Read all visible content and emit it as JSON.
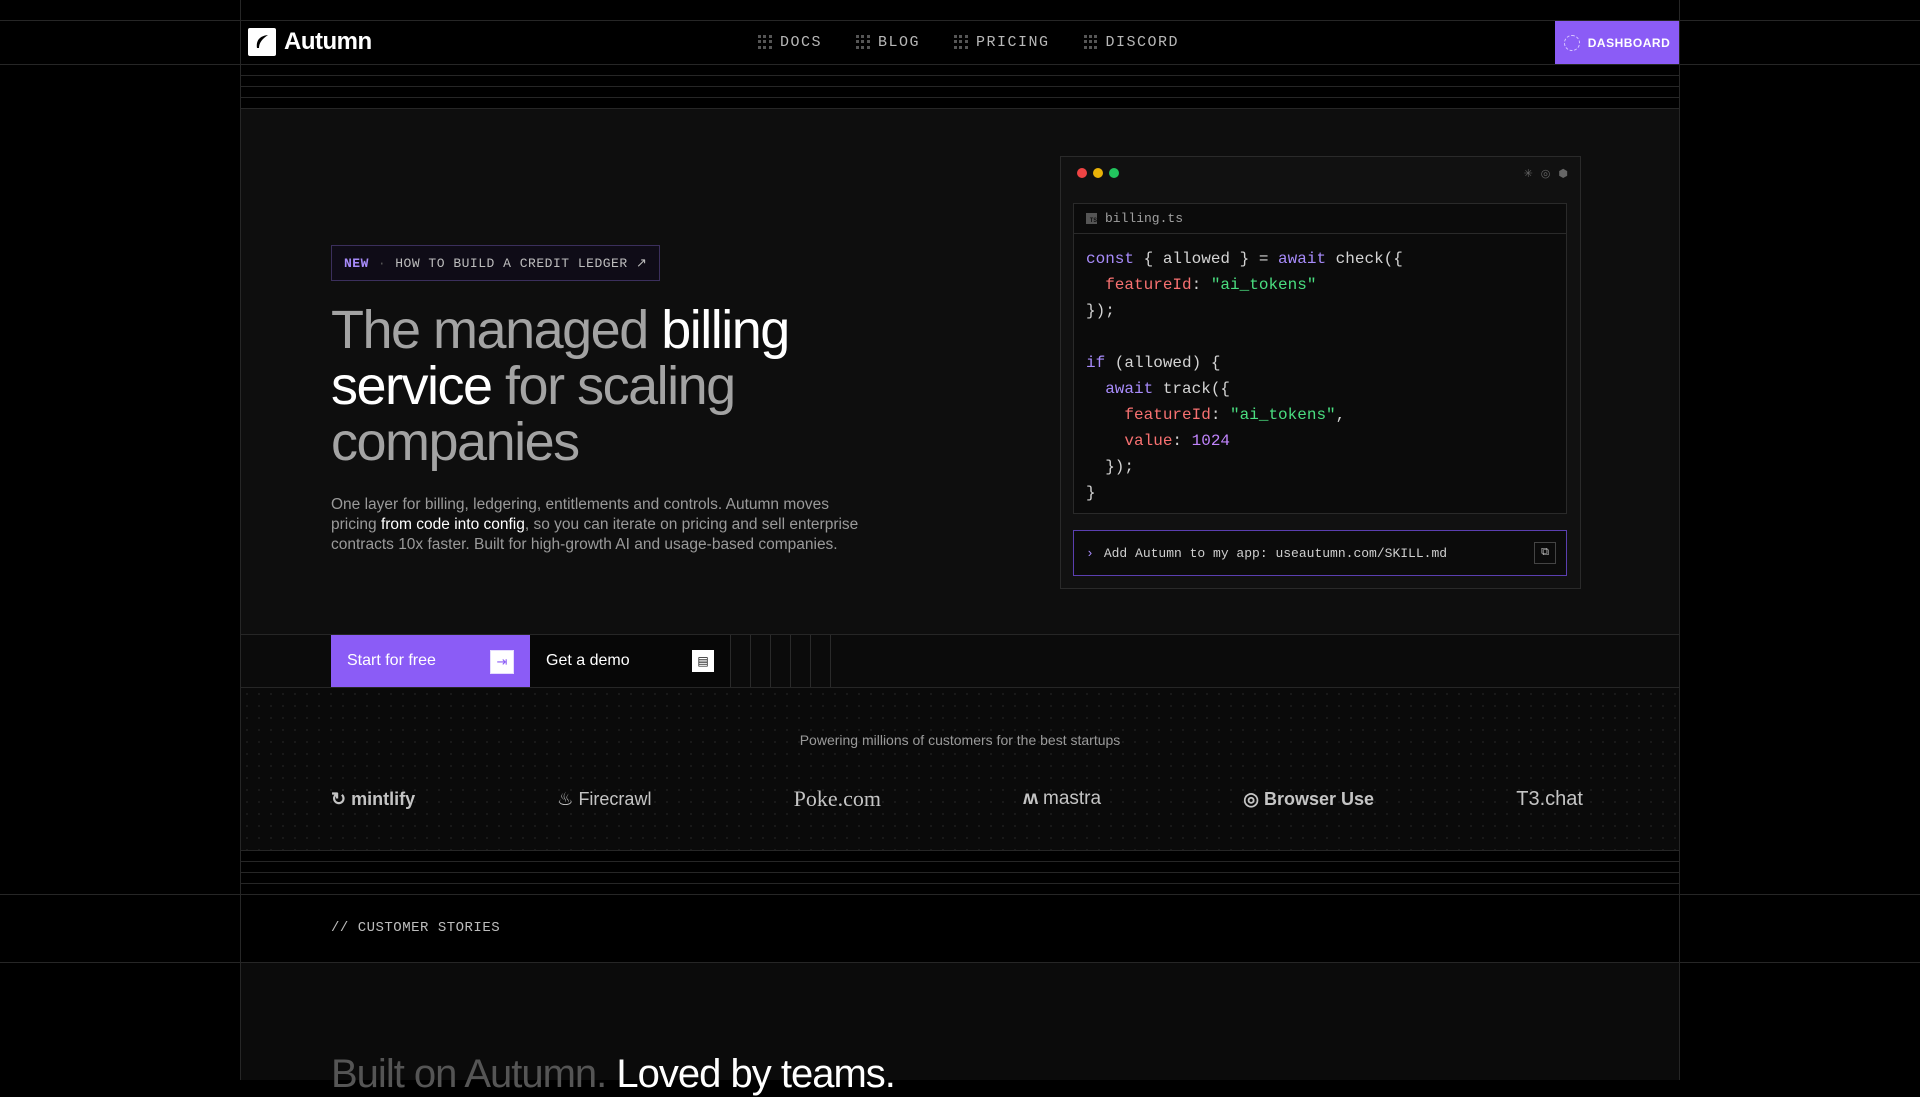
{
  "brand": {
    "name": "Autumn"
  },
  "nav": {
    "items": [
      {
        "label": "DOCS"
      },
      {
        "label": "BLOG"
      },
      {
        "label": "PRICING"
      },
      {
        "label": "DISCORD"
      }
    ],
    "dashboard_label": "DASHBOARD"
  },
  "hero": {
    "badge_new": "NEW",
    "badge_sep": "·",
    "badge_text": "HOW TO BUILD A CREDIT LEDGER ↗",
    "headline": {
      "p1": "The managed ",
      "p2": "billing",
      "p3": "service",
      "p4": " for scaling companies"
    },
    "sub": {
      "p1": "One layer for billing, ledgering, entitlements and controls. Autumn moves pricing ",
      "p2": "from code into config",
      "p3": ", so you can iterate on pricing and sell enterprise contracts 10x faster. Built for high-growth AI and usage-based companies."
    }
  },
  "code": {
    "filename": "billing.ts",
    "tokens": {
      "const": "const",
      "check_head": " { allowed } = ",
      "await": "await",
      "check_call": " check({",
      "featureId": "featureId",
      "colon": ": ",
      "ai_tokens": "\"ai_tokens\"",
      "close": "});",
      "if": "if",
      "if_cond": " (allowed) {",
      "track_call": " track({",
      "comma": ",",
      "value": "value",
      "num": "1024",
      "inner_close": "});",
      "brace": "}"
    },
    "prompt": "Add Autumn to my app: useautumn.com/SKILL.md",
    "prompt_chevron": "›"
  },
  "cta": {
    "primary_label": "Start for free",
    "secondary_label": "Get a demo"
  },
  "customers": {
    "powered_text": "Powering millions of customers for the best startups",
    "logos": [
      "mintlify",
      "Firecrawl",
      "Poke.com",
      "mastra",
      "Browser Use",
      "T3.chat"
    ]
  },
  "stories": {
    "label": "// CUSTOMER STORIES",
    "title_dim": "Built on Autumn.",
    "title_bright": " Loved by teams."
  },
  "colors": {
    "accent": "#8b5cf6",
    "background": "#000000",
    "panel": "#0e0e0e"
  }
}
